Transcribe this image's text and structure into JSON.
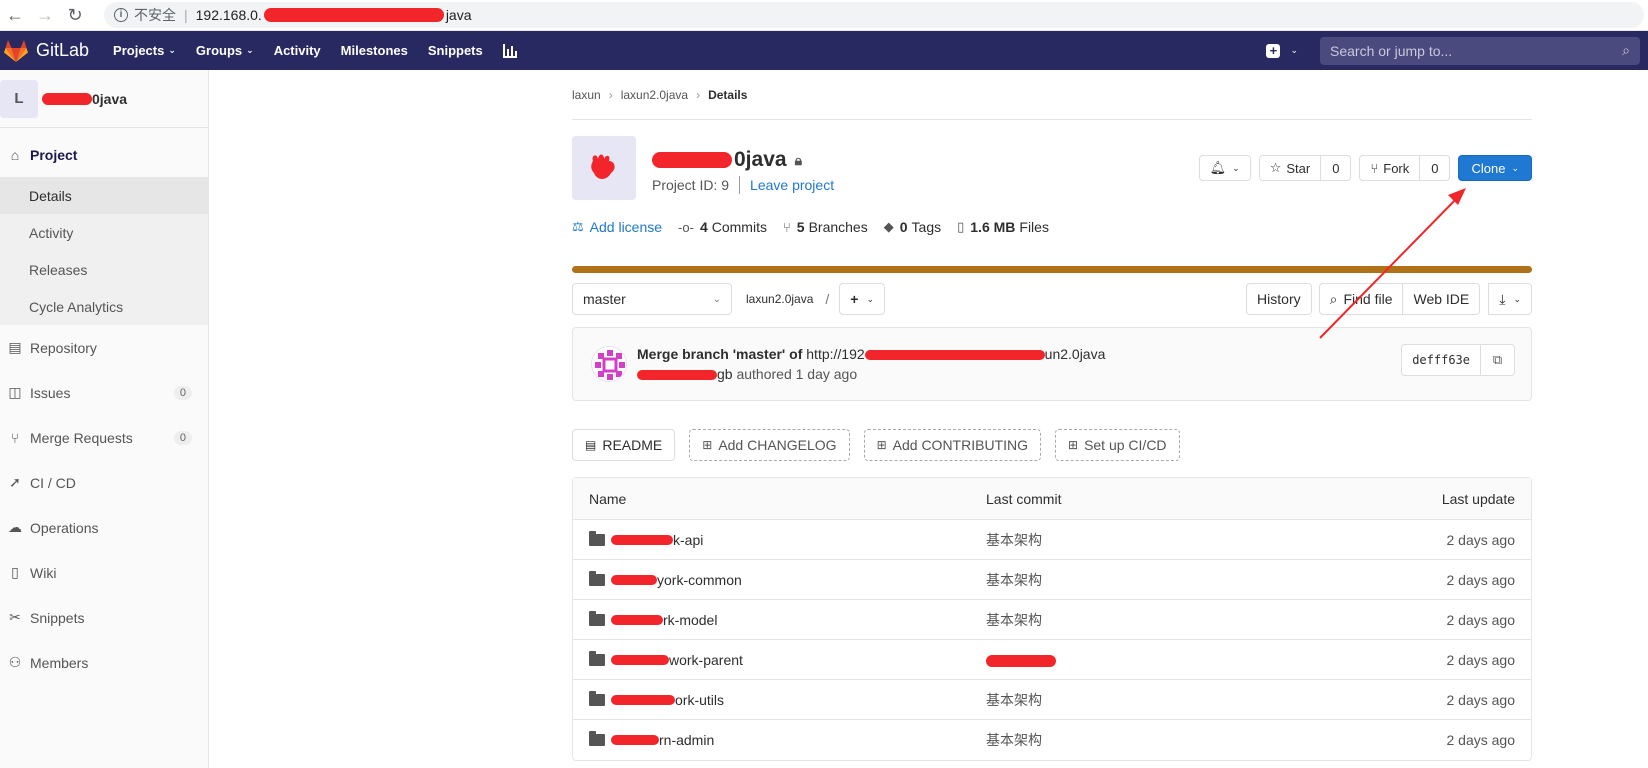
{
  "browser": {
    "insecure_label": "不安全",
    "url_prefix": "192.168.0.",
    "url_suffix": "java"
  },
  "header": {
    "logo_text": "GitLab",
    "nav": [
      {
        "label": "Projects",
        "dropdown": true
      },
      {
        "label": "Groups",
        "dropdown": true
      },
      {
        "label": "Activity",
        "dropdown": false
      },
      {
        "label": "Milestones",
        "dropdown": false
      },
      {
        "label": "Snippets",
        "dropdown": false
      }
    ],
    "search_placeholder": "Search or jump to..."
  },
  "sidebar": {
    "avatar_letter": "L",
    "project_name_suffix": "0java",
    "project_label": "Project",
    "sub_items": [
      "Details",
      "Activity",
      "Releases",
      "Cycle Analytics"
    ],
    "items": [
      {
        "label": "Repository",
        "icon": "book-icon"
      },
      {
        "label": "Issues",
        "icon": "issues-icon",
        "badge": "0"
      },
      {
        "label": "Merge Requests",
        "icon": "merge-request-icon",
        "badge": "0"
      },
      {
        "label": "CI / CD",
        "icon": "rocket-icon"
      },
      {
        "label": "Operations",
        "icon": "cloud-icon"
      },
      {
        "label": "Wiki",
        "icon": "wiki-icon"
      },
      {
        "label": "Snippets",
        "icon": "scissors-icon"
      },
      {
        "label": "Members",
        "icon": "users-icon"
      }
    ]
  },
  "breadcrumb": [
    "laxun",
    "laxun2.0java",
    "Details"
  ],
  "project": {
    "title_suffix": "0java",
    "id_label": "Project ID: 9",
    "leave_label": "Leave project",
    "star_label": "Star",
    "star_count": "0",
    "fork_label": "Fork",
    "fork_count": "0",
    "clone_label": "Clone"
  },
  "stats": {
    "license": "Add license",
    "commits_count": "4",
    "commits_label": "Commits",
    "branches_count": "5",
    "branches_label": "Branches",
    "tags_count": "0",
    "tags_label": "Tags",
    "files_size": "1.6 MB",
    "files_label": "Files"
  },
  "tree": {
    "branch": "master",
    "path": "laxun2.0java",
    "path_sep": "/",
    "history": "History",
    "find_file": "Find file",
    "web_ide": "Web IDE"
  },
  "commit": {
    "title": "Merge branch 'master' of",
    "url_prefix": "http://192",
    "url_suffix": "un2.0java",
    "author_suffix": "gb",
    "authored": "authored 1 day ago",
    "sha": "defff63e"
  },
  "quick": {
    "readme": "README",
    "changelog": "Add CHANGELOG",
    "contributing": "Add CONTRIBUTING",
    "cicd": "Set up CI/CD"
  },
  "files": {
    "headers": {
      "name": "Name",
      "commit": "Last commit",
      "date": "Last update"
    },
    "rows": [
      {
        "name": "k-api",
        "commit": "基本架构",
        "date": "2 days ago"
      },
      {
        "name": "york-common",
        "commit": "基本架构",
        "date": "2 days ago"
      },
      {
        "name": "rk-model",
        "commit": "基本架构",
        "date": "2 days ago"
      },
      {
        "name": "work-parent",
        "commit": "",
        "date": "2 days ago"
      },
      {
        "name": "ork-utils",
        "commit": "基本架构",
        "date": "2 days ago"
      },
      {
        "name": "rn-admin",
        "commit": "基本架构",
        "date": "2 days ago"
      }
    ]
  },
  "colors": {
    "header_bg": "#292961",
    "clone_button": "#1f78d1",
    "language_bar": "#b07219",
    "annotation_red": "#f2262a"
  }
}
